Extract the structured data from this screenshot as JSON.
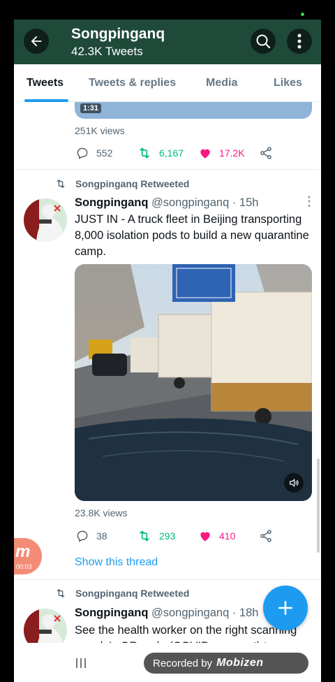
{
  "header": {
    "title": "Songpinganq",
    "subtitle": "42.3K Tweets"
  },
  "tabs": [
    {
      "label": "Tweets"
    },
    {
      "label": "Tweets & replies"
    },
    {
      "label": "Media"
    },
    {
      "label": "Likes"
    }
  ],
  "prev_tweet": {
    "video_duration": "1:31",
    "views": "251K views",
    "replies": "552",
    "retweets": "6,167",
    "likes": "17.2K"
  },
  "tweet1": {
    "retweet_label": "Songpinganq Retweeted",
    "name": "Songpinganq",
    "handle": "@songpinganq · 15h",
    "text": "JUST IN - A truck fleet in Beijing transporting 8,000 isolation pods to build a new quarantine camp.",
    "views": "23.8K views",
    "replies": "38",
    "retweets": "293",
    "likes": "410",
    "thread_link": "Show this thread"
  },
  "tweet2": {
    "retweet_label": "Songpinganq Retweeted",
    "name": "Songpinganq",
    "handle": "@songpinganq · 18h",
    "text": "See the health worker on the right scanning people's QR code (COVID passport) to"
  },
  "recorder": {
    "badge_letter": "m",
    "badge_time": "00:03",
    "pill_text": "Recorded by",
    "pill_logo": "Mobizen"
  },
  "colors": {
    "header_bg": "#1f4a3a",
    "accent": "#1d9bf0",
    "retweet_green": "#00ba7c",
    "like_pink": "#f91880"
  },
  "icons": [
    "back-arrow-icon",
    "search-icon",
    "more-vertical-icon",
    "reply-icon",
    "retweet-icon",
    "heart-icon",
    "share-icon",
    "sound-icon",
    "compose-plus-icon",
    "recent-apps-icon"
  ]
}
